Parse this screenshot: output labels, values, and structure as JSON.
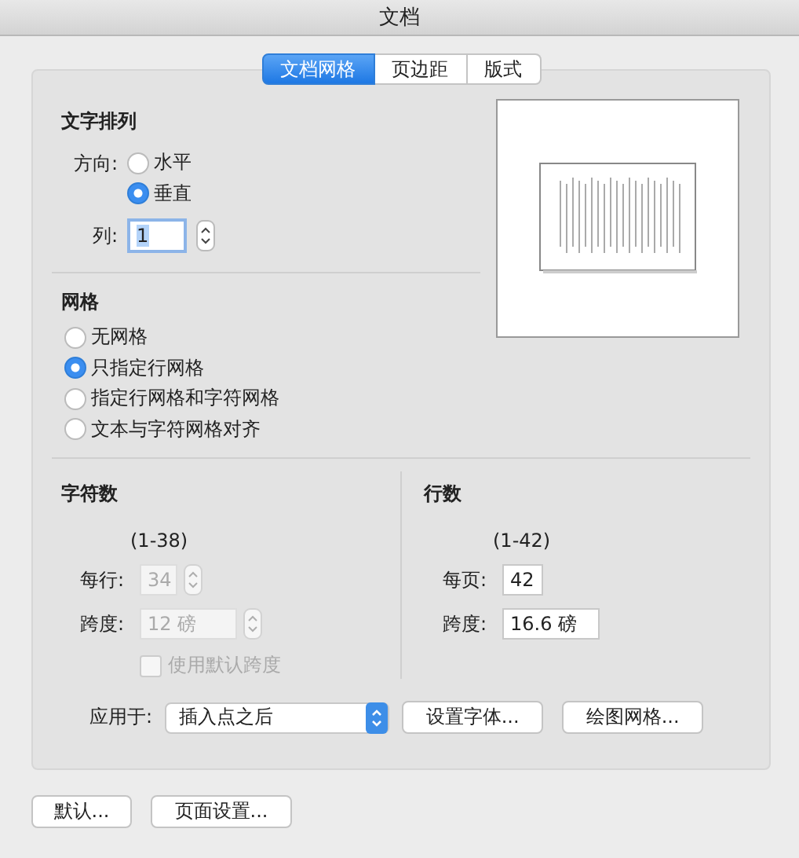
{
  "window": {
    "title": "文档"
  },
  "tabs": [
    {
      "label": "文档网格",
      "selected": true
    },
    {
      "label": "页边距",
      "selected": false
    },
    {
      "label": "版式",
      "selected": false
    }
  ],
  "text_direction": {
    "heading": "文字排列",
    "direction_label": "方向:",
    "options": [
      {
        "label": "水平",
        "selected": false
      },
      {
        "label": "垂直",
        "selected": true
      }
    ],
    "columns_label": "列:",
    "columns_value": "1"
  },
  "grid": {
    "heading": "网格",
    "options": [
      {
        "label": "无网格",
        "selected": false
      },
      {
        "label": "只指定行网格",
        "selected": true
      },
      {
        "label": "指定行网格和字符网格",
        "selected": false
      },
      {
        "label": "文本与字符网格对齐",
        "selected": false
      }
    ]
  },
  "characters": {
    "heading": "字符数",
    "range": "(1-38)",
    "per_line_label": "每行:",
    "per_line_value": "34",
    "pitch_label": "跨度:",
    "pitch_value": "12 磅",
    "disabled": true,
    "default_pitch": {
      "label": "使用默认跨度",
      "checked": false,
      "disabled": true
    }
  },
  "lines": {
    "heading": "行数",
    "range": "(1-42)",
    "per_page_label": "每页:",
    "per_page_value": "42",
    "pitch_label": "跨度:",
    "pitch_value": "16.6 磅"
  },
  "apply": {
    "label": "应用于:",
    "value": "插入点之后"
  },
  "buttons": [
    "设置字体...",
    "绘图网格..."
  ],
  "footer_buttons": [
    "默认...",
    "页面设置..."
  ]
}
